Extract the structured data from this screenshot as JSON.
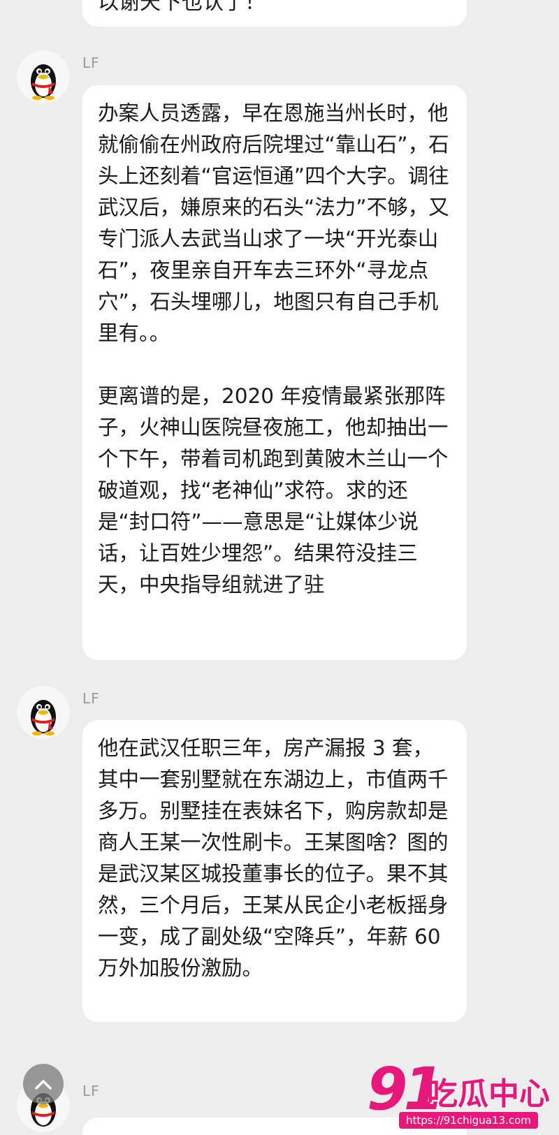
{
  "top_partial_message": {
    "text": "以谢天下也认了！"
  },
  "messages": [
    {
      "sender": "LF",
      "paragraphs": [
        "办案人员透露，早在恩施当州长时，他就偷偷在州政府后院埋过“靠山石”，石头上还刻着“官运恒通”四个大字。调往武汉后，嫌原来的石头“法力”不够，又专门派人去武当山求了一块“开光泰山石”，夜里亲自开车去三环外“寻龙点穴”，石头埋哪儿，地图只有自己手机里有。。",
        "更离谱的是，2020 年疫情最紧张那阵子，火神山医院昼夜施工，他却抽出一个下午，带着司机跑到黄陂木兰山一个破道观，找“老神仙”求符。求的还是“封口符”——意思是“让媒体少说话，让百姓少埋怨”。结果符没挂三天，中央指导组就进了驻"
      ]
    },
    {
      "sender": "LF",
      "paragraphs": [
        "他在武汉任职三年，房产漏报 3 套，其中一套别墅就在东湖边上，市值两千多万。别墅挂在表妹名下，购房款却是商人王某一次性刷卡。王某图啥？图的是武汉某区城投董事长的位子。果不其然，三个月后，王某从民企小老板摇身一变，成了副处级“空降兵”，年薪 60 万外加股份激励。"
      ]
    },
    {
      "sender": "LF",
      "paragraphs": []
    }
  ],
  "watermark": {
    "number": "91",
    "title": "吃瓜中心",
    "url": "https://91chigua13.com"
  },
  "icons": {
    "avatar": "qq-penguin-icon",
    "scroll_top": "chevron-up-icon"
  },
  "colors": {
    "background": "#ededed",
    "bubble": "#ffffff",
    "watermark": "#e8177a"
  }
}
